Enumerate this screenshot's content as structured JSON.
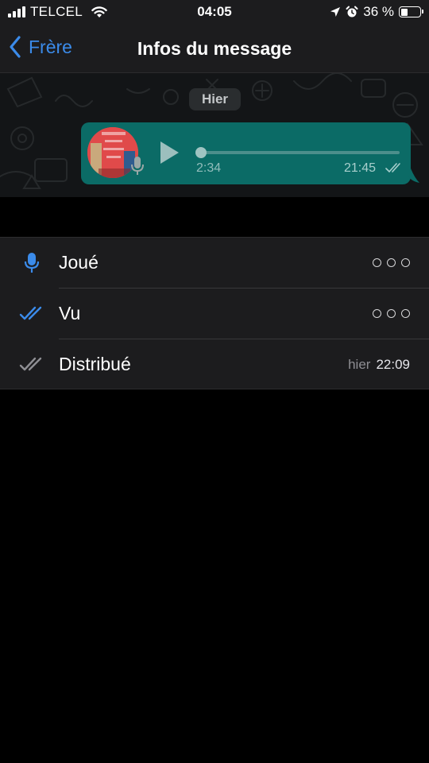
{
  "status_bar": {
    "carrier": "TELCEL",
    "time": "04:05",
    "battery": "36 %",
    "battery_level": 0.36
  },
  "nav": {
    "back_label": "Frère",
    "title": "Infos du message"
  },
  "chat": {
    "date_chip": "Hier",
    "voice_message": {
      "duration": "2:34",
      "time": "21:45",
      "playback_progress": 0
    }
  },
  "info": {
    "rows": [
      {
        "label": "Joué",
        "value": "dots"
      },
      {
        "label": "Vu",
        "value": "dots"
      },
      {
        "label": "Distribué",
        "day": "hier",
        "time": "22:09"
      }
    ]
  },
  "colors": {
    "accent_blue": "#3b8bea",
    "bubble_green": "#0b6b66",
    "list_background": "#1c1c1e",
    "tick_gray": "#8e8e93"
  },
  "icons": {
    "carrier_signal": "cellular-signal-icon",
    "wifi": "wifi-icon",
    "location": "location-arrow-icon",
    "alarm": "alarm-clock-icon",
    "battery": "battery-icon",
    "back": "chevron-left-icon",
    "played": "microphone-icon",
    "read": "double-check-blue-icon",
    "delivered": "double-check-gray-icon"
  }
}
